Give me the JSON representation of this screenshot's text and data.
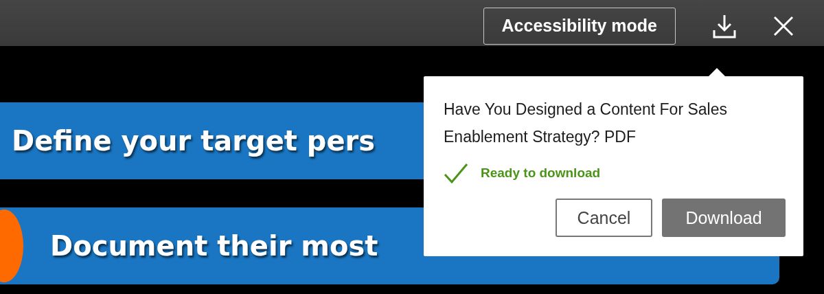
{
  "toolbar": {
    "accessibility_button": "Accessibility mode"
  },
  "slide": {
    "banners": [
      {
        "text": "Define your target pers",
        "marker": false
      },
      {
        "text": "Document their most",
        "marker": true
      }
    ]
  },
  "download_popup": {
    "title": "Have You Designed a Content For Sales Enablement Strategy? PDF",
    "status": "Ready to download",
    "buttons": [
      {
        "label": "Cancel",
        "kind": "secondary"
      },
      {
        "label": "Download",
        "kind": "primary"
      }
    ]
  }
}
